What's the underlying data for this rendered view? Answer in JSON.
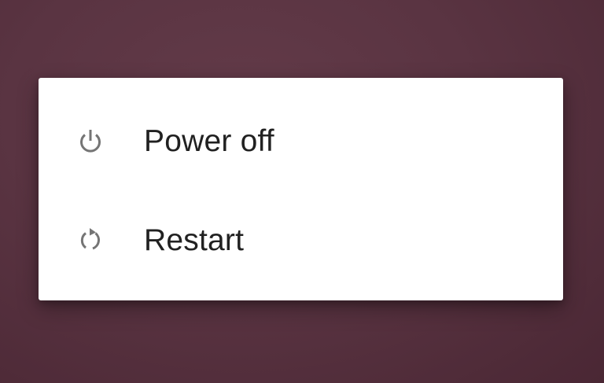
{
  "power_menu": {
    "items": [
      {
        "label": "Power off",
        "icon": "power-icon"
      },
      {
        "label": "Restart",
        "icon": "restart-icon"
      }
    ]
  },
  "colors": {
    "wallpaper": "#5a3442",
    "dialog_background": "#ffffff",
    "label_text": "#212121",
    "icon": "#757575"
  }
}
